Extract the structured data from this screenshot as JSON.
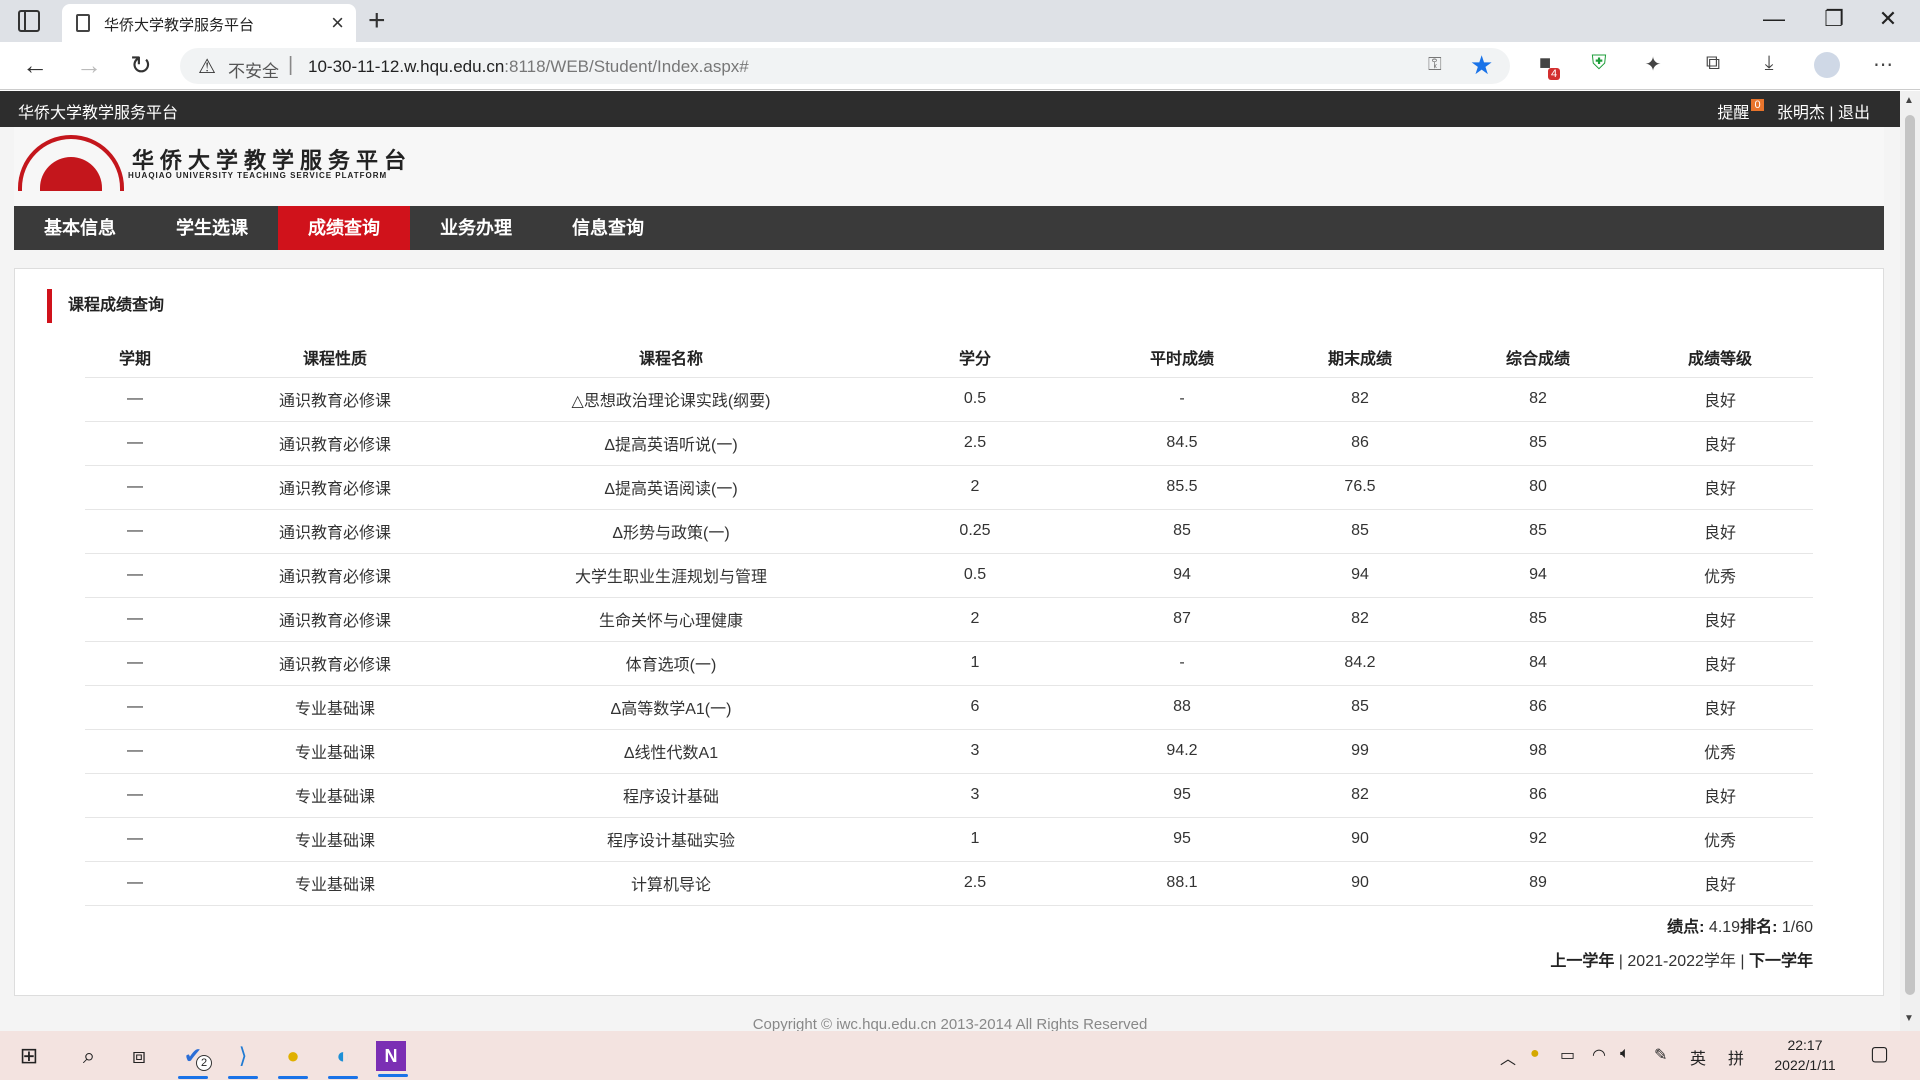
{
  "browser": {
    "tab_title": "华侨大学教学服务平台",
    "insecure_label": "不安全",
    "url_host": "10-30-11-12.w.hqu.edu.cn",
    "url_path": ":8118/WEB/Student/Index.aspx#",
    "ext_badge": "4"
  },
  "topbar": {
    "brand": "华侨大学教学服务平台",
    "remind_label": "提醒",
    "remind_count": "0",
    "username": "张明杰",
    "logout": "退出",
    "divider": "|"
  },
  "logo": {
    "cn": "华侨大学教学服务平台",
    "en": "HUAQIAO UNIVERSITY TEACHING SERVICE PLATFORM"
  },
  "nav": [
    "基本信息",
    "学生选课",
    "成绩查询",
    "业务办理",
    "信息查询"
  ],
  "panel": {
    "title": "课程成绩查询"
  },
  "table": {
    "headers": [
      "学期",
      "课程性质",
      "课程名称",
      "学分",
      "平时成绩",
      "期末成绩",
      "综合成绩",
      "成绩等级"
    ],
    "rows": [
      [
        "—",
        "通识教育必修课",
        "△思想政治理论课实践(纲要)",
        "0.5",
        "-",
        "82",
        "82",
        "良好"
      ],
      [
        "—",
        "通识教育必修课",
        "Δ提高英语听说(一)",
        "2.5",
        "84.5",
        "86",
        "85",
        "良好"
      ],
      [
        "—",
        "通识教育必修课",
        "Δ提高英语阅读(一)",
        "2",
        "85.5",
        "76.5",
        "80",
        "良好"
      ],
      [
        "—",
        "通识教育必修课",
        "Δ形势与政策(一)",
        "0.25",
        "85",
        "85",
        "85",
        "良好"
      ],
      [
        "—",
        "通识教育必修课",
        "大学生职业生涯规划与管理",
        "0.5",
        "94",
        "94",
        "94",
        "优秀"
      ],
      [
        "—",
        "通识教育必修课",
        "生命关怀与心理健康",
        "2",
        "87",
        "82",
        "85",
        "良好"
      ],
      [
        "—",
        "通识教育必修课",
        "体育选项(一)",
        "1",
        "-",
        "84.2",
        "84",
        "良好"
      ],
      [
        "—",
        "专业基础课",
        "Δ高等数学A1(一)",
        "6",
        "88",
        "85",
        "86",
        "良好"
      ],
      [
        "—",
        "专业基础课",
        "Δ线性代数A1",
        "3",
        "94.2",
        "99",
        "98",
        "优秀"
      ],
      [
        "—",
        "专业基础课",
        "程序设计基础",
        "3",
        "95",
        "82",
        "86",
        "良好"
      ],
      [
        "—",
        "专业基础课",
        "程序设计基础实验",
        "1",
        "95",
        "90",
        "92",
        "优秀"
      ],
      [
        "—",
        "专业基础课",
        "计算机导论",
        "2.5",
        "88.1",
        "90",
        "89",
        "良好"
      ]
    ]
  },
  "summary": {
    "gpa_label": "绩点:",
    "gpa_value": "4.19",
    "rank_label": "排名:",
    "rank_value": "1/60"
  },
  "yearnav": {
    "prev": "上一学年",
    "current": "2021-2022学年",
    "next": "下一学年",
    "sep": "|"
  },
  "footer": "Copyright © iwc.hqu.edu.cn 2013-2014 All Rights Reserved",
  "taskbar": {
    "todo_badge": "2",
    "ime_lang": "英",
    "ime_mode": "拼",
    "time": "22:17",
    "date": "2022/1/11"
  }
}
